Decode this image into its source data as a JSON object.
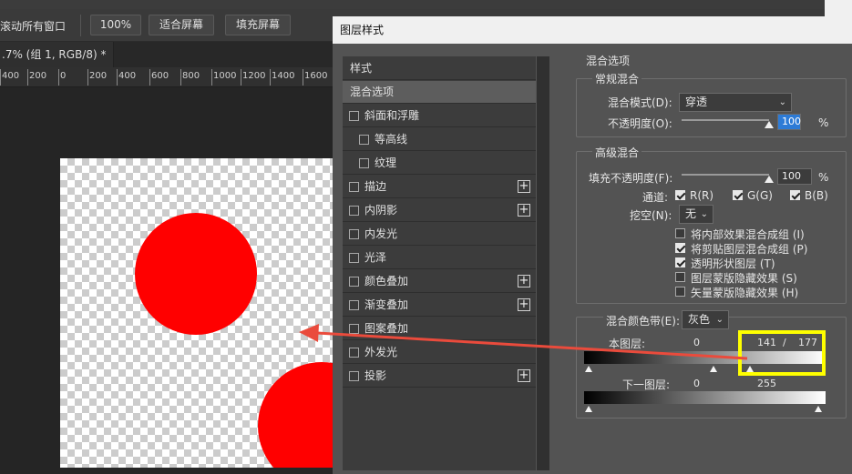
{
  "options_bar": {
    "scroll_all": "滚动所有窗口",
    "zoom": "100%",
    "fit_screen": "适合屏幕",
    "fill_screen": "填充屏幕"
  },
  "document": {
    "tab_title": ".7% (组 1, RGB/8) *",
    "close": "×"
  },
  "ruler": {
    "ticks": [
      "400",
      "200",
      "0",
      "200",
      "400",
      "600",
      "800",
      "1000",
      "1200",
      "1400",
      "1600"
    ]
  },
  "dialog": {
    "title": "图层样式",
    "styles_header": "样式",
    "items": [
      {
        "label": "混合选项",
        "selected": true,
        "checkbox": false,
        "indent": false,
        "plus": false
      },
      {
        "label": "斜面和浮雕",
        "checkbox": true,
        "indent": false,
        "plus": false
      },
      {
        "label": "等高线",
        "checkbox": true,
        "indent": true,
        "plus": false
      },
      {
        "label": "纹理",
        "checkbox": true,
        "indent": true,
        "plus": false
      },
      {
        "label": "描边",
        "checkbox": true,
        "indent": false,
        "plus": true
      },
      {
        "label": "内阴影",
        "checkbox": true,
        "indent": false,
        "plus": true
      },
      {
        "label": "内发光",
        "checkbox": true,
        "indent": false,
        "plus": false
      },
      {
        "label": "光泽",
        "checkbox": true,
        "indent": false,
        "plus": false
      },
      {
        "label": "颜色叠加",
        "checkbox": true,
        "indent": false,
        "plus": true
      },
      {
        "label": "渐变叠加",
        "checkbox": true,
        "indent": false,
        "plus": true
      },
      {
        "label": "图案叠加",
        "checkbox": true,
        "indent": false,
        "plus": false
      },
      {
        "label": "外发光",
        "checkbox": true,
        "indent": false,
        "plus": false
      },
      {
        "label": "投影",
        "checkbox": true,
        "indent": false,
        "plus": true
      }
    ],
    "blend_options": {
      "section_title": "混合选项",
      "general": {
        "title": "常规混合",
        "blend_mode_label": "混合模式(D):",
        "blend_mode_value": "穿透",
        "opacity_label": "不透明度(O):",
        "opacity_value": "100",
        "opacity_unit": "%",
        "opacity_level": 1.0
      },
      "advanced": {
        "title": "高级混合",
        "fill_opacity_label": "填充不透明度(F):",
        "fill_opacity_value": "100",
        "fill_opacity_unit": "%",
        "fill_opacity_level": 1.0,
        "channels_label": "通道:",
        "channel_r": "R(R)",
        "channel_g": "G(G)",
        "channel_b": "B(B)",
        "knockout_label": "挖空(N):",
        "knockout_value": "无",
        "options": [
          {
            "label": "将内部效果混合成组 (I)",
            "checked": false
          },
          {
            "label": "将剪贴图层混合成组 (P)",
            "checked": true
          },
          {
            "label": "透明形状图层 (T)",
            "checked": true
          },
          {
            "label": "图层蒙版隐藏效果 (S)",
            "checked": false
          },
          {
            "label": "矢量蒙版隐藏效果 (H)",
            "checked": false
          }
        ]
      },
      "blend_if": {
        "label": "混合颜色带(E):",
        "value": "灰色",
        "this_layer_label": "本图层:",
        "this_layer_min": "0",
        "this_layer_high_a": "141",
        "separator": "/",
        "this_layer_high_b": "177",
        "underlying_label": "下一图层:",
        "underlying_min": "0",
        "underlying_max": "255"
      }
    }
  },
  "colors": {
    "accent_red": "#ff0000",
    "highlight": "#ffff00",
    "selection_blue": "#2d7bd6"
  }
}
